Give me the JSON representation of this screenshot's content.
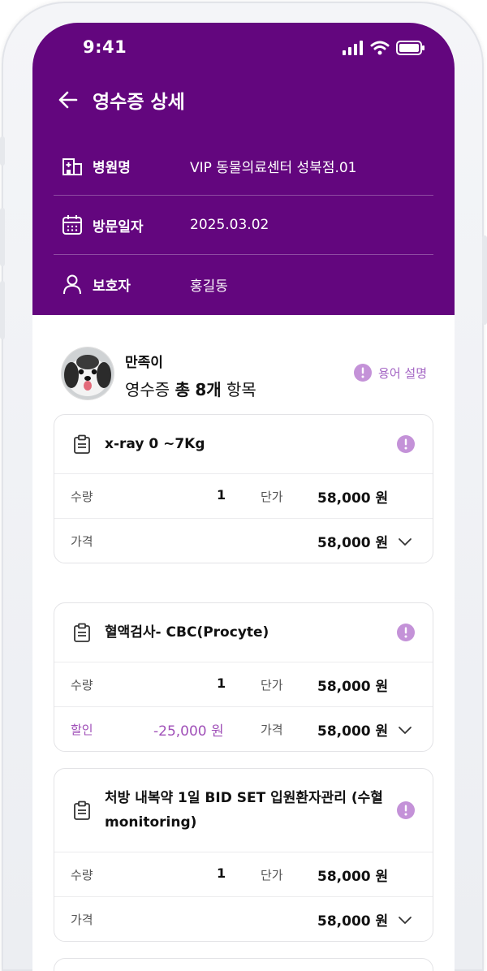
{
  "status_bar": {
    "time": "9:41"
  },
  "header": {
    "title": "영수증 상세",
    "rows": [
      {
        "label": "병원명",
        "value": "VIP 동물의료센터 성북점.01",
        "icon": "hospital-building-icon"
      },
      {
        "label": "방문일자",
        "value": "2025.03.02",
        "icon": "calendar-icon"
      },
      {
        "label": "보호자",
        "value": "홍길동",
        "icon": "person-icon"
      }
    ]
  },
  "pet": {
    "name": "만족이",
    "receipt_prefix": "영수증",
    "receipt_total_label": "총",
    "receipt_count": "8개",
    "receipt_suffix": "항목"
  },
  "term_button": {
    "label": "용어 설명",
    "icon": "info-circle-icon"
  },
  "items": [
    {
      "title": "x-ray 0 ~7Kg",
      "qty_label": "수량",
      "qty": "1",
      "unit_label": "단가",
      "unit_price": "58,000 원",
      "price_label": "가격",
      "price": "58,000 원"
    },
    {
      "title": "혈액검사- CBC(Procyte)",
      "qty_label": "수량",
      "qty": "1",
      "unit_label": "단가",
      "unit_price": "58,000 원",
      "discount_label": "할인",
      "discount": "-25,000 원",
      "price_label": "가격",
      "price": "58,000 원"
    },
    {
      "title": "처방 내복약 1일 BID SET 입원환자관리 (수혈 monitoring)",
      "qty_label": "수량",
      "qty": "1",
      "unit_label": "단가",
      "unit_price": "58,000 원",
      "price_label": "가격",
      "price": "58,000 원"
    }
  ],
  "colors": {
    "primary": "#63067e",
    "accent": "#a466c4",
    "discount": "#a050b8"
  }
}
